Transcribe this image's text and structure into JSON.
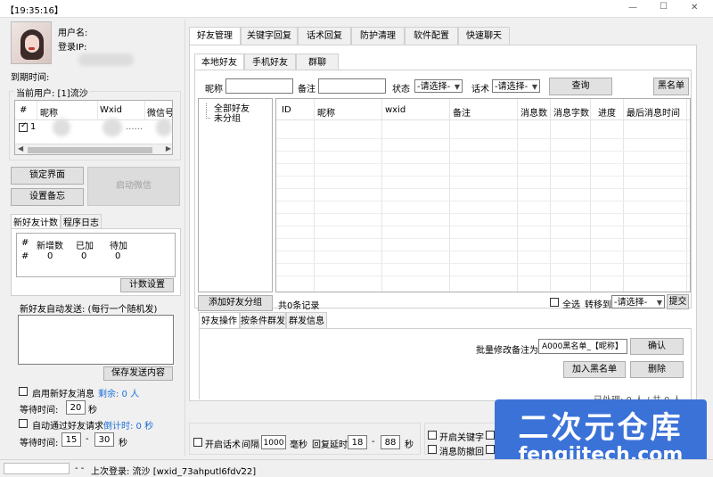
{
  "window": {
    "title": "【19:35:16】",
    "controls": {
      "min": "—",
      "max": "☐",
      "close": "✕"
    }
  },
  "user": {
    "username_label": "用户名:",
    "ip_label": "登录IP:",
    "expire_label": "到期时间:",
    "current_user": "当前用户: [1]流沙"
  },
  "user_table": {
    "headers": [
      "#",
      "昵称",
      "Wxid",
      "微信号"
    ],
    "rows": [
      {
        "idx": "1",
        "wxid_dots": "......"
      }
    ]
  },
  "left_buttons": {
    "lock": "锁定界面",
    "set_remark": "设置备忘",
    "start_wechat": "启动微信"
  },
  "left_tabs": {
    "t1": "新好友计数",
    "t2": "程序日志"
  },
  "count_table": {
    "headers": [
      "#",
      "新增数",
      "已加",
      "待加"
    ],
    "row": [
      "#",
      "0",
      "0",
      "0"
    ]
  },
  "count_settings": "计数设置",
  "auto_send": {
    "label": "新好友自动发送: (每行一个随机发)",
    "save": "保存发送内容"
  },
  "enable_new_friend": {
    "label": "启用新好友消息",
    "remain": "剩余: 0 人"
  },
  "wait1": {
    "label": "等待时间:",
    "value": "20",
    "unit": "秒"
  },
  "auto_accept": {
    "label": "自动通过好友请求",
    "countdown": "倒计时: 0 秒"
  },
  "wait2": {
    "label": "等待时间:",
    "from": "15",
    "dash": "-",
    "to": "30",
    "unit": "秒"
  },
  "main_tabs": [
    "好友管理",
    "关键字回复",
    "话术回复",
    "防护清理",
    "软件配置",
    "快速聊天"
  ],
  "sub_tabs": [
    "本地好友",
    "手机好友",
    "群聊"
  ],
  "search": {
    "nick_label": "昵称",
    "remark_label": "备注",
    "status_label": "状态",
    "status_value": "-请选择-",
    "script_label": "话术",
    "script_value": "-请选择-",
    "query": "查询",
    "blacklist": "黑名单"
  },
  "group_tree": {
    "all": "全部好友",
    "ungrouped": "未分组"
  },
  "friend_table_headers": [
    "ID",
    "昵称",
    "wxid",
    "备注",
    "消息数",
    "消息字数",
    "进度",
    "最后消息时间"
  ],
  "add_group_button": "添加好友分组",
  "record_count": "共0条记录",
  "select_all": "全选",
  "move_to": {
    "label": "转移到",
    "value": "-请选择-",
    "submit": "提交"
  },
  "op_tabs": [
    "好友操作",
    "按条件群发",
    "群发信息"
  ],
  "batch": {
    "label": "批量修改备注为",
    "value": "A000黑名单_【昵称】",
    "confirm": "确认",
    "add_black": "加入黑名单",
    "delete": "删除",
    "processed": "已处理: 0 人 / 共 0 人"
  },
  "bottom": {
    "script_enable": "开启话术",
    "interval_label": "间隔",
    "interval_value": "1000",
    "ms": "毫秒",
    "reply_delay": "回复延时",
    "delay_from": "18",
    "dash": "-",
    "delay_to": "88",
    "sec": "秒",
    "keyword": "开启关键字",
    "anti_recall": "消息防撤回"
  },
  "status_bar": {
    "dashes": "- -",
    "last_login": "上次登录: 流沙 [wxid_73ahputl6fdv22]",
    "tail": "-"
  },
  "watermark": {
    "title": "二次元仓库",
    "site": "fengjitech.com"
  },
  "colors": {
    "accent_blue": "#1e6fd6",
    "watermark_bg": "#3b72d8",
    "watermark_orange": "#e88a2b"
  }
}
